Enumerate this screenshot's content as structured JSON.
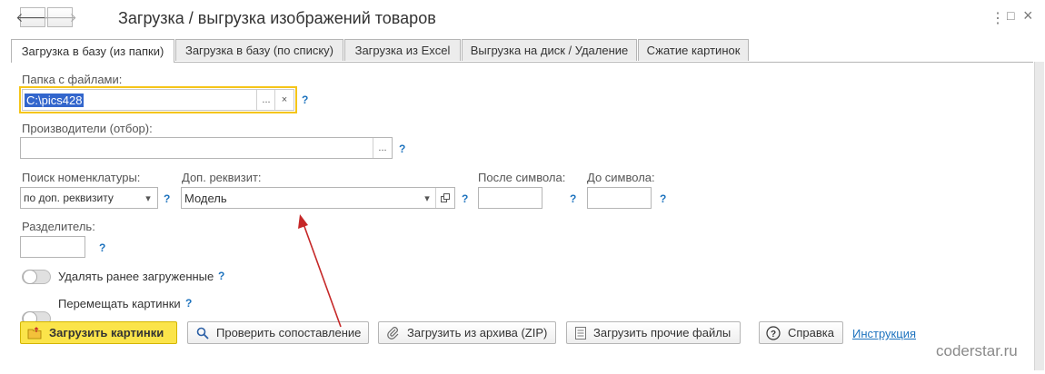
{
  "window": {
    "title": "Загрузка / выгрузка изображений товаров",
    "more_glyph": "⋮",
    "restore_glyph": "□",
    "close_glyph": "×"
  },
  "tabs": [
    {
      "label": "Загрузка в базу (из папки)",
      "active": true
    },
    {
      "label": "Загрузка в базу (по списку)",
      "active": false
    },
    {
      "label": "Загрузка из Excel",
      "active": false
    },
    {
      "label": "Выгрузка на диск / Удаление",
      "active": false
    },
    {
      "label": "Сжатие картинок",
      "active": false
    }
  ],
  "form": {
    "folder": {
      "label": "Папка с файлами:",
      "value": "C:\\pics428"
    },
    "manufacturers": {
      "label": "Производители (отбор):",
      "value": ""
    },
    "search": {
      "label": "Поиск номенклатуры:",
      "value": "по доп. реквизиту"
    },
    "extra_attr": {
      "label": "Доп. реквизит:",
      "value": "Модель"
    },
    "after_symbol": {
      "label": "После символа:",
      "value": ""
    },
    "before_symbol": {
      "label": "До символа:",
      "value": ""
    },
    "separator": {
      "label": "Разделитель:",
      "value": ""
    },
    "delete_loaded": {
      "label": "Удалять ранее загруженные",
      "on": false
    },
    "move_pictures": {
      "label": "Перемещать картинки",
      "on": false
    },
    "help_mark": "?",
    "ellipsis_glyph": "...",
    "clear_glyph": "×",
    "dropdown_glyph": "▾"
  },
  "buttons": {
    "load_pictures": "Загрузить картинки",
    "check_mapping": "Проверить сопоставление",
    "load_zip": "Загрузить из архива (ZIP)",
    "load_other": "Загрузить прочие файлы",
    "help": "Справка",
    "instruction_link": "Инструкция"
  },
  "watermark": "coderstar.ru",
  "colors": {
    "accent_yellow": "#fbe44a",
    "focus_border": "#f5c518",
    "link_blue": "#1e73be",
    "arrow_red": "#c62828",
    "selection_blue": "#3366cc"
  }
}
